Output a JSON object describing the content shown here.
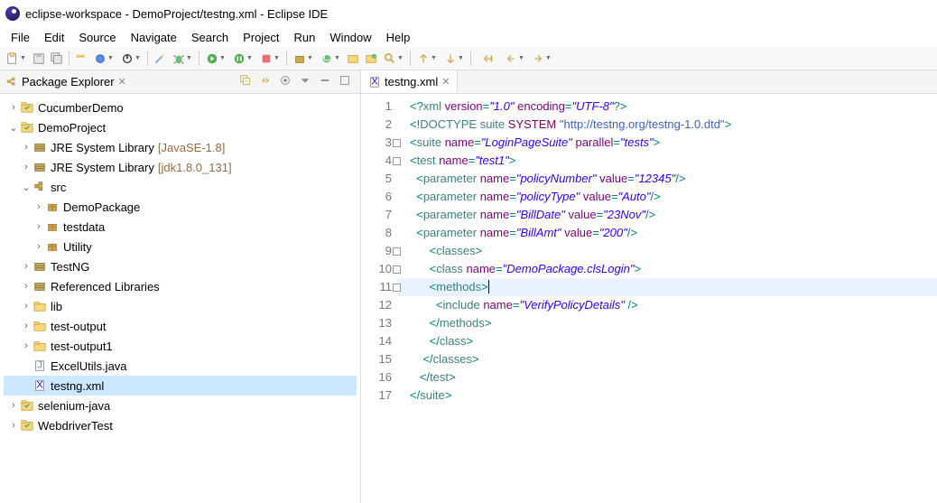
{
  "title": "eclipse-workspace - DemoProject/testng.xml - Eclipse IDE",
  "menu": [
    "File",
    "Edit",
    "Source",
    "Navigate",
    "Search",
    "Project",
    "Run",
    "Window",
    "Help"
  ],
  "pkg_explorer_title": "Package Explorer",
  "editor_tab": "testng.xml",
  "tree": [
    {
      "lvl": 0,
      "tw": ">",
      "icon": "proj",
      "label": "CucumberDemo"
    },
    {
      "lvl": 0,
      "tw": "v",
      "icon": "proj",
      "label": "DemoProject"
    },
    {
      "lvl": 1,
      "tw": ">",
      "icon": "jre",
      "label": "JRE System Library",
      "deco": "[JavaSE-1.8]"
    },
    {
      "lvl": 1,
      "tw": ">",
      "icon": "jre",
      "label": "JRE System Library",
      "deco": "[jdk1.8.0_131]"
    },
    {
      "lvl": 1,
      "tw": "v",
      "icon": "src",
      "label": "src"
    },
    {
      "lvl": 2,
      "tw": ">",
      "icon": "pkg",
      "label": "DemoPackage"
    },
    {
      "lvl": 2,
      "tw": ">",
      "icon": "pkg",
      "label": "testdata"
    },
    {
      "lvl": 2,
      "tw": ">",
      "icon": "pkg",
      "label": "Utility"
    },
    {
      "lvl": 1,
      "tw": ">",
      "icon": "jre",
      "label": "TestNG"
    },
    {
      "lvl": 1,
      "tw": ">",
      "icon": "jre",
      "label": "Referenced Libraries"
    },
    {
      "lvl": 1,
      "tw": ">",
      "icon": "fld",
      "label": "lib"
    },
    {
      "lvl": 1,
      "tw": ">",
      "icon": "fld",
      "label": "test-output"
    },
    {
      "lvl": 1,
      "tw": ">",
      "icon": "fld",
      "label": "test-output1"
    },
    {
      "lvl": 1,
      "tw": "",
      "icon": "jfile",
      "label": "ExcelUtils.java"
    },
    {
      "lvl": 1,
      "tw": "",
      "icon": "xfile",
      "label": "testng.xml",
      "selected": true
    },
    {
      "lvl": 0,
      "tw": ">",
      "icon": "proj",
      "label": "selenium-java"
    },
    {
      "lvl": 0,
      "tw": ">",
      "icon": "proj",
      "label": "WebdriverTest"
    }
  ],
  "code": {
    "lines": [
      {
        "n": "1",
        "html": "<span class='c-pun'>&lt;?</span><span class='c-tag'>xml</span> <span class='c-attr'>version</span><span class='c-pun'>=</span><span class='c-str'>\"1.0\"</span> <span class='c-attr'>encoding</span><span class='c-pun'>=</span><span class='c-str'>\"UTF-8\"</span><span class='c-pun'>?&gt;</span>"
      },
      {
        "n": "2",
        "html": "<span class='c-pun'>&lt;!</span><span class='c-tag'>DOCTYPE</span> <span class='c-tag'>suite</span> <span class='c-kw'>SYSTEM</span> <span class='c-sys'>\"http://testng.org/testng-1.0.dtd\"</span><span class='c-pun'>&gt;</span>"
      },
      {
        "n": "3",
        "fold": true,
        "html": "<span class='c-pun'>&lt;</span><span class='c-tag'>suite</span> <span class='c-attr'>name</span><span class='c-pun'>=</span><span class='c-str'>\"LoginPageSuite\"</span> <span class='c-attr'>parallel</span><span class='c-pun'>=</span><span class='c-str'>\"tests\"</span><span class='c-pun'>&gt;</span>"
      },
      {
        "n": "4",
        "fold": true,
        "html": "<span class='c-pun'>&lt;</span><span class='c-tag'>test</span> <span class='c-attr'>name</span><span class='c-pun'>=</span><span class='c-str'>\"test1\"</span><span class='c-pun'>&gt;</span>"
      },
      {
        "n": "5",
        "html": "  <span class='c-pun'>&lt;</span><span class='c-tag'>parameter</span> <span class='c-attr'>name</span><span class='c-pun'>=</span><span class='c-str'>\"policyNumber\"</span> <span class='c-attr'>value</span><span class='c-pun'>=</span><span class='c-str'>\"12345\"</span><span class='c-pun'>/&gt;</span>"
      },
      {
        "n": "6",
        "html": "  <span class='c-pun'>&lt;</span><span class='c-tag'>parameter</span> <span class='c-attr'>name</span><span class='c-pun'>=</span><span class='c-str'>\"policyType\"</span> <span class='c-attr'>value</span><span class='c-pun'>=</span><span class='c-str'>\"Auto\"</span><span class='c-pun'>/&gt;</span>"
      },
      {
        "n": "7",
        "html": "  <span class='c-pun'>&lt;</span><span class='c-tag'>parameter</span> <span class='c-attr'>name</span><span class='c-pun'>=</span><span class='c-str'>\"BillDate\"</span> <span class='c-attr'>value</span><span class='c-pun'>=</span><span class='c-str'>\"23Nov\"</span><span class='c-pun'>/&gt;</span>"
      },
      {
        "n": "8",
        "html": "  <span class='c-pun'>&lt;</span><span class='c-tag'>parameter</span> <span class='c-attr'>name</span><span class='c-pun'>=</span><span class='c-str'>\"BillAmt\"</span> <span class='c-attr'>value</span><span class='c-pun'>=</span><span class='c-str'>\"200\"</span><span class='c-pun'>/&gt;</span>"
      },
      {
        "n": "9",
        "fold": true,
        "html": "      <span class='c-pun'>&lt;</span><span class='c-tag'>classes</span><span class='c-pun'>&gt;</span>"
      },
      {
        "n": "10",
        "fold": true,
        "html": "      <span class='c-pun'>&lt;</span><span class='c-tag'>class</span> <span class='c-attr'>name</span><span class='c-pun'>=</span><span class='c-str'>\"DemoPackage.clsLogin\"</span><span class='c-pun'>&gt;</span>"
      },
      {
        "n": "11",
        "fold": true,
        "hl": true,
        "html": "      <span class='c-pun'>&lt;</span><span class='c-tag'>methods</span><span class='c-pun'>&gt;</span><span class='cursor'></span>"
      },
      {
        "n": "12",
        "html": "        <span class='c-pun'>&lt;</span><span class='c-tag'>include</span> <span class='c-attr'>name</span><span class='c-pun'>=</span><span class='c-str'>\"VerifyPolicyDetails\"</span> <span class='c-pun'>/&gt;</span>"
      },
      {
        "n": "13",
        "html": "      <span class='c-pun'>&lt;/</span><span class='c-tag'>methods</span><span class='c-pun'>&gt;</span>"
      },
      {
        "n": "14",
        "html": "      <span class='c-pun'>&lt;/</span><span class='c-tag'>class</span><span class='c-pun'>&gt;</span>"
      },
      {
        "n": "15",
        "html": "    <span class='c-pun'>&lt;/</span><span class='c-tag'>classes</span><span class='c-pun'>&gt;</span>"
      },
      {
        "n": "16",
        "html": "   <span class='c-pun'>&lt;/</span><span class='c-tag'>test</span><span class='c-pun'>&gt;</span>"
      },
      {
        "n": "17",
        "html": "<span class='c-pun'>&lt;/</span><span class='c-tag'>suite</span><span class='c-pun'>&gt;</span>"
      }
    ]
  }
}
